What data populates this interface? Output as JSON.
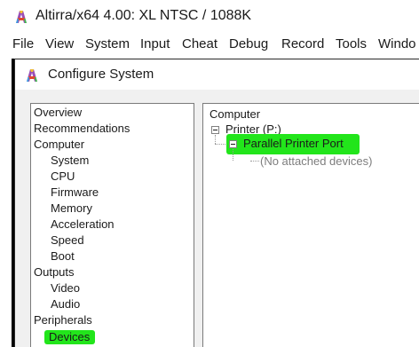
{
  "app": {
    "title": "Altirra/x64 4.00: XL NTSC / 1088K",
    "icon": "altirra-logo-icon"
  },
  "menubar": {
    "items": [
      {
        "label": "File"
      },
      {
        "label": "View"
      },
      {
        "label": "System"
      },
      {
        "label": "Input"
      },
      {
        "label": "Cheat"
      },
      {
        "label": "Debug"
      },
      {
        "label": "Record"
      },
      {
        "label": "Tools"
      },
      {
        "label": "Windo"
      }
    ]
  },
  "dialog": {
    "title": "Configure System",
    "icon": "altirra-logo-icon",
    "categories": [
      {
        "label": "Overview",
        "level": 0
      },
      {
        "label": "Recommendations",
        "level": 0
      },
      {
        "label": "Computer",
        "level": 0
      },
      {
        "label": "System",
        "level": 1
      },
      {
        "label": "CPU",
        "level": 1
      },
      {
        "label": "Firmware",
        "level": 1
      },
      {
        "label": "Memory",
        "level": 1
      },
      {
        "label": "Acceleration",
        "level": 1
      },
      {
        "label": "Speed",
        "level": 1
      },
      {
        "label": "Boot",
        "level": 1
      },
      {
        "label": "Outputs",
        "level": 0
      },
      {
        "label": "Video",
        "level": 1
      },
      {
        "label": "Audio",
        "level": 1
      },
      {
        "label": "Peripherals",
        "level": 0
      },
      {
        "label": "Devices",
        "level": 1,
        "selected": true
      }
    ],
    "device_tree": {
      "root": "Computer",
      "printer": "Printer (P:)",
      "port": "Parallel Printer Port",
      "empty": "(No attached devices)"
    }
  },
  "colors": {
    "highlight_green": "#22e51b",
    "selected_row": "#dcdcdc",
    "muted_text": "#7d7d7d"
  }
}
